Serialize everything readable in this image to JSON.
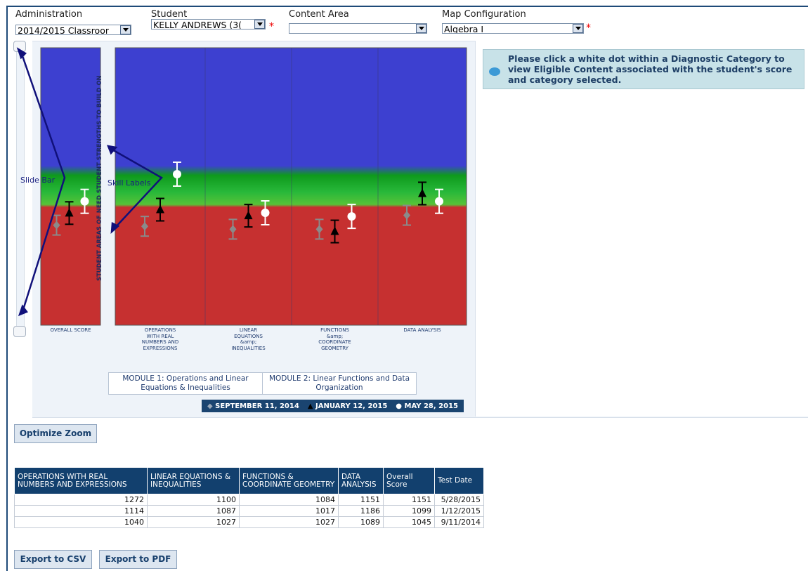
{
  "filters": {
    "administration": {
      "label": "Administration",
      "value": "2014/2015 Classroor"
    },
    "student": {
      "label": "Student",
      "value": "KELLY ANDREWS (3("
    },
    "content_area": {
      "label": "Content Area",
      "value": ""
    },
    "map_configuration": {
      "label": "Map Configuration",
      "value": "Algebra I"
    },
    "required_mark": "*"
  },
  "info_message": "Please click a white dot within a Diagnostic Category to view Eligible Content associated with the student's score and category selected.",
  "chart": {
    "vertical_label": "STUDENT AREAS OF NEED STUDENT STRENGTHS TO BUILD ON",
    "annotations": {
      "slide_bar": "Slide Bar",
      "skill_labels": "Skill Labels"
    },
    "categories": [
      "OVERALL SCORE",
      "OPERATIONS WITH REAL NUMBERS AND EXPRESSIONS",
      "LINEAR EQUATIONS &amp; INEQUALITIES",
      "FUNCTIONS &amp; COORDINATE GEOMETRY",
      "DATA ANALYSIS"
    ],
    "category_lines": [
      [
        "OVERALL SCORE"
      ],
      [
        "OPERATIONS",
        "WITH REAL",
        "NUMBERS AND",
        "EXPRESSIONS"
      ],
      [
        "LINEAR",
        "EQUATIONS",
        "&amp;",
        "INEQUALITIES"
      ],
      [
        "FUNCTIONS",
        "&amp;",
        "COORDINATE",
        "GEOMETRY"
      ],
      [
        "DATA ANALYSIS"
      ]
    ],
    "modules": [
      "MODULE 1: Operations and Linear Equations & Inequalities",
      "MODULE 2: Linear Functions and Data Organization"
    ],
    "legend": [
      {
        "symbol": "◆",
        "label": "SEPTEMBER 11, 2014"
      },
      {
        "symbol": "▲",
        "label": "JANUARY 12, 2015"
      },
      {
        "symbol": "●",
        "label": "MAY 28, 2015"
      }
    ],
    "colors": {
      "strength": "#3d40d0",
      "transition": "#1ea82a",
      "need": "#c63030",
      "sep": "#8a8a8a",
      "jan": "#000000",
      "may": "#ffffff"
    }
  },
  "chart_data": {
    "type": "scatter",
    "categories": [
      "OVERALL SCORE",
      "OPERATIONS WITH REAL NUMBERS AND EXPRESSIONS",
      "LINEAR EQUATIONS &amp; INEQUALITIES",
      "FUNCTIONS &amp; COORDINATE GEOMETRY",
      "DATA ANALYSIS"
    ],
    "series": [
      {
        "name": "SEPTEMBER 11, 2014",
        "values": [
          1045,
          1040,
          1027,
          1027,
          1089
        ]
      },
      {
        "name": "JANUARY 12, 2015",
        "values": [
          1099,
          1114,
          1087,
          1017,
          1186
        ]
      },
      {
        "name": "MAY 28, 2015",
        "values": [
          1151,
          1272,
          1100,
          1084,
          1151
        ]
      }
    ]
  },
  "buttons": {
    "optimize_zoom": "Optimize Zoom",
    "export_csv": "Export to CSV",
    "export_pdf": "Export to PDF"
  },
  "table": {
    "headers": [
      "OPERATIONS WITH REAL NUMBERS AND EXPRESSIONS",
      "LINEAR EQUATIONS & INEQUALITIES",
      "FUNCTIONS & COORDINATE GEOMETRY",
      "DATA ANALYSIS",
      "Overall Score",
      "Test Date"
    ],
    "rows": [
      [
        "1272",
        "1100",
        "1084",
        "1151",
        "1151",
        "5/28/2015"
      ],
      [
        "1114",
        "1087",
        "1017",
        "1186",
        "1099",
        "1/12/2015"
      ],
      [
        "1040",
        "1027",
        "1027",
        "1089",
        "1045",
        "9/11/2014"
      ]
    ]
  }
}
